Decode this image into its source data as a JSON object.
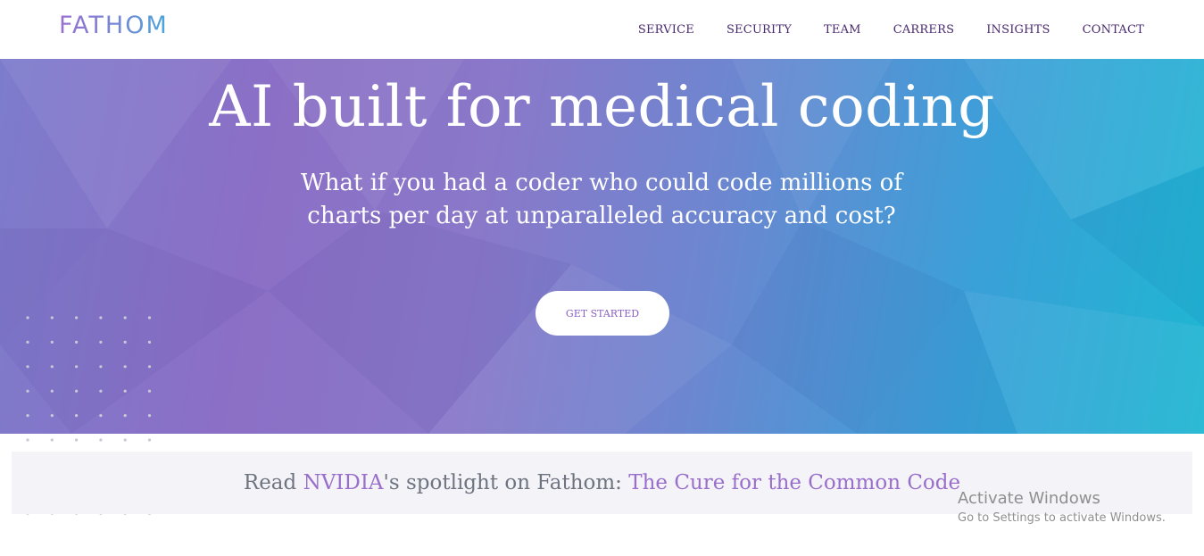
{
  "brand": {
    "name": "FATHOM"
  },
  "nav": {
    "items": [
      "SERVICE",
      "SECURITY",
      "TEAM",
      "CARRERS",
      "INSIGHTS",
      "CONTACT"
    ]
  },
  "hero": {
    "title": "AI built for medical coding",
    "subtitle": "What if you had a coder who could code millions of charts per day at unparalleled accuracy and cost?",
    "cta_label": "GET STARTED"
  },
  "banner": {
    "prefix": "Read ",
    "nvidia": "NVIDIA",
    "middle": "'s spotlight on Fathom: ",
    "article": "The Cure for the Common Code"
  },
  "os_watermark": {
    "title": "Activate Windows",
    "subtitle": "Go to Settings to activate Windows."
  },
  "colors": {
    "brand_purple": "#9a6fcb",
    "nav_text": "#4a2a6e",
    "hero_gradient_start": "#8b6fc6",
    "hero_gradient_end": "#1fb6d2"
  }
}
